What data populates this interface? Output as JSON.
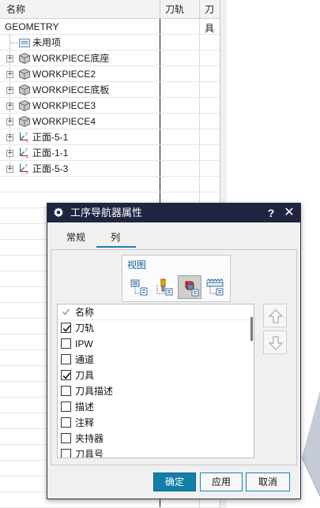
{
  "navigator": {
    "columns": {
      "name": "名称",
      "toolpath": "刀轨",
      "tool": "刀具"
    },
    "root": "GEOMETRY",
    "items": [
      {
        "label": "未用项",
        "icon": "folder-icon"
      },
      {
        "label": "WORKPIECE底座",
        "icon": "workpiece-icon"
      },
      {
        "label": "WORKPIECE2",
        "icon": "workpiece-icon"
      },
      {
        "label": "WORKPIECE底板",
        "icon": "workpiece-icon"
      },
      {
        "label": "WORKPIECE3",
        "icon": "workpiece-icon"
      },
      {
        "label": "WORKPIECE4",
        "icon": "workpiece-icon"
      },
      {
        "label": "正面-5-1",
        "icon": "mcs-icon"
      },
      {
        "label": "正面-1-1",
        "icon": "mcs-icon"
      },
      {
        "label": "正面-5-3",
        "icon": "mcs-icon"
      }
    ]
  },
  "dialog": {
    "title": "工序导航器属性",
    "help_glyph": "?",
    "close_glyph": "✕",
    "tabs": {
      "general": "常规",
      "columns": "列"
    },
    "active_tab": "列",
    "view_label": "视图",
    "view_buttons": [
      {
        "icon": "program-order-view-icon",
        "selected": false
      },
      {
        "icon": "machine-tool-view-icon",
        "selected": false
      },
      {
        "icon": "geometry-view-icon",
        "selected": true
      },
      {
        "icon": "machining-method-view-icon",
        "selected": false
      }
    ],
    "column_list": [
      {
        "label": "名称",
        "checked": true,
        "disabled": true
      },
      {
        "label": "刀轨",
        "checked": true,
        "disabled": false
      },
      {
        "label": "IPW",
        "checked": false,
        "disabled": false
      },
      {
        "label": "通道",
        "checked": false,
        "disabled": false
      },
      {
        "label": "刀具",
        "checked": true,
        "disabled": false
      },
      {
        "label": "刀具描述",
        "checked": false,
        "disabled": false
      },
      {
        "label": "描述",
        "checked": false,
        "disabled": false
      },
      {
        "label": "注释",
        "checked": false,
        "disabled": false
      },
      {
        "label": "夹持器",
        "checked": false,
        "disabled": false
      },
      {
        "label": "刀具号",
        "checked": false,
        "disabled": false
      }
    ],
    "buttons": {
      "ok": "确定",
      "apply": "应用",
      "cancel": "取消"
    }
  },
  "colors": {
    "title_bar": "#1f2541",
    "accent": "#127fa6",
    "view_label": "#0f5fa3"
  }
}
